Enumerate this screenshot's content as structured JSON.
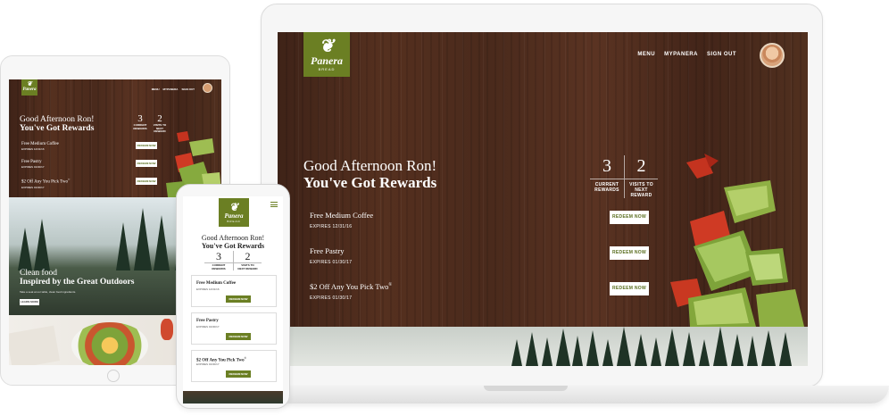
{
  "laptop": {
    "brand": {
      "name": "Panera",
      "sub": "BREAD"
    },
    "nav": {
      "menu": "MENU",
      "mypanera": "MYPANERA",
      "signout": "SIGN OUT"
    },
    "greeting": {
      "line1": "Good Afternoon Ron!",
      "line2": "You've Got Rewards"
    },
    "stats": {
      "current": {
        "value": "3",
        "label_1": "CURRENT",
        "label_2": "REWARDS"
      },
      "visits": {
        "value": "2",
        "label_1": "VISITS TO",
        "label_2": "NEXT",
        "label_3": "REWARD"
      }
    },
    "offers": [
      {
        "title": "Free Medium Coffee",
        "expires": "EXPIRES 12/31/16",
        "button": "REDEEM NOW"
      },
      {
        "title": "Free Pastry",
        "expires": "EXPIRES 01/30/17",
        "button": "REDEEM NOW"
      },
      {
        "title": "$2 Off Any You Pick Two",
        "mark": "®",
        "expires": "EXPIRES 01/30/17",
        "button": "REDEEM NOW"
      }
    ]
  },
  "tablet": {
    "brand": {
      "name": "Panera",
      "sub": "BREAD"
    },
    "nav": {
      "menu": "MENU",
      "mypanera": "MYPANERA",
      "signout": "SIGN OUT"
    },
    "greeting": {
      "line1": "Good Afternoon Ron!",
      "line2": "You've Got Rewards"
    },
    "stats": {
      "current": {
        "value": "3",
        "label": "CURRENT REWARDS"
      },
      "visits": {
        "value": "2",
        "label": "VISITS TO NEXT REWARD"
      }
    },
    "offers": [
      {
        "title": "Free Medium Coffee",
        "expires": "EXPIRES 12/31/16",
        "button": "REDEEM NOW"
      },
      {
        "title": "Free Pastry",
        "expires": "EXPIRES 01/30/17",
        "button": "REDEEM NOW"
      },
      {
        "title": "$2 Off Any You Pick Two",
        "mark": "®",
        "expires": "EXPIRES 01/30/17",
        "button": "REDEEM NOW"
      }
    ],
    "feature": {
      "line1": "Clean food",
      "line2": "Inspired by the Great Outdoors",
      "subtext": "Take a seat at our table, clean food ingredients.",
      "button": "LEARN MORE"
    }
  },
  "phone": {
    "brand": {
      "name": "Panera",
      "sub": "BREAD"
    },
    "menu_icon": "hamburger-icon",
    "greeting": {
      "line1": "Good Afternoon Ron!",
      "line2": "You've Got Rewards"
    },
    "stats": {
      "current": {
        "value": "3",
        "label_1": "CURRENT",
        "label_2": "REWARDS"
      },
      "visits": {
        "value": "2",
        "label_1": "VISITS TO",
        "label_2": "NEXT REWARD"
      }
    },
    "offers": [
      {
        "title": "Free Medium Coffee",
        "expires": "EXPIRES 12/31/16",
        "button": "REDEEM NOW"
      },
      {
        "title": "Free Pastry",
        "expires": "EXPIRES 01/30/17",
        "button": "REDEEM NOW"
      },
      {
        "title": "$2 Off Any You Pick Two",
        "mark": "®",
        "expires": "EXPIRES 01/30/17",
        "button": "REDEEM NOW"
      }
    ]
  },
  "colors": {
    "brand_green": "#6b7f23",
    "wood_dark": "#4a2a1e",
    "button_text": "#5a6e1f",
    "white": "#ffffff"
  },
  "icons": {
    "logo": "panera-leaf-icon",
    "avatar": "user-avatar",
    "menu": "hamburger-icon"
  }
}
